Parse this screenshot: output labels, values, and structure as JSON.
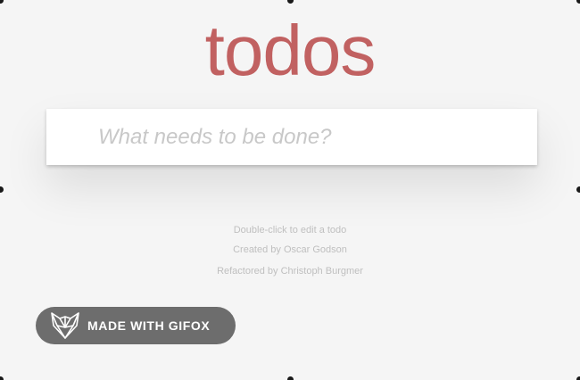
{
  "app": {
    "title": "todos"
  },
  "new_todo": {
    "placeholder": "What needs to be done?",
    "value": ""
  },
  "footer_info": {
    "hint": "Double-click to edit a todo",
    "created_by": "Created by Oscar Godson",
    "refactored_by": "Refactored by Christoph Burgmer"
  },
  "badge": {
    "label": "MADE WITH GIFOX",
    "icon": "fox-icon"
  },
  "colors": {
    "title": "#af2f2f",
    "background": "#f5f5f5",
    "placeholder": "#c8c8c8",
    "info_text": "#bfbfbf",
    "badge_background": "#5a5a5a"
  }
}
